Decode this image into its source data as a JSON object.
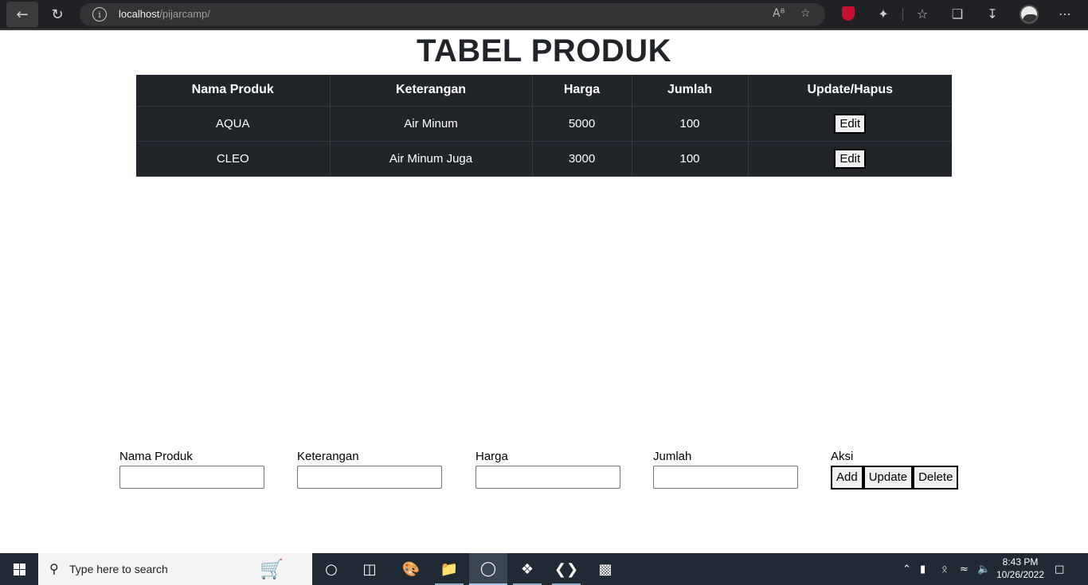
{
  "browser": {
    "url_host": "localhost",
    "url_path": "/pijarcamp/"
  },
  "page": {
    "title": "TABEL PRODUK",
    "table": {
      "headers": [
        "Nama Produk",
        "Keterangan",
        "Harga",
        "Jumlah",
        "Update/Hapus"
      ],
      "rows": [
        {
          "nama": "AQUA",
          "keterangan": "Air Minum",
          "harga": "5000",
          "jumlah": "100",
          "action": "Edit"
        },
        {
          "nama": "CLEO",
          "keterangan": "Air Minum Juga",
          "harga": "3000",
          "jumlah": "100",
          "action": "Edit"
        }
      ]
    },
    "form": {
      "nama_label": "Nama Produk",
      "keterangan_label": "Keterangan",
      "harga_label": "Harga",
      "jumlah_label": "Jumlah",
      "aksi_label": "Aksi",
      "add_label": "Add",
      "update_label": "Update",
      "delete_label": "Delete"
    }
  },
  "taskbar": {
    "search_placeholder": "Type here to search",
    "time": "8:43 PM",
    "date": "10/26/2022"
  }
}
